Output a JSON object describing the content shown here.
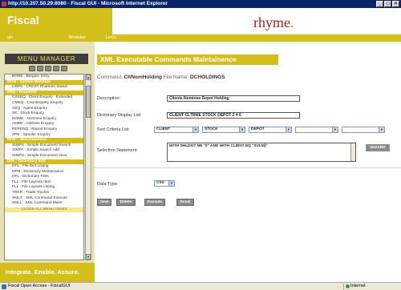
{
  "window": {
    "title": "http://10.207.50.29:8080 - Fiscal GUI - Microsoft Internet Explorer"
  },
  "header": {
    "brand": "Fiscal",
    "logo": "rhyme"
  },
  "nav": {
    "items": [
      "gin",
      "Modules",
      "Links"
    ]
  },
  "sidebar": {
    "title": "MENU MANAGER",
    "tagline": "Integrate. Enable. Assure.",
    "menu": [
      {
        "type": "item",
        "label": "BGNE : Bargain Entry"
      },
      {
        "type": "section",
        "label": "MON : System Monitors"
      },
      {
        "type": "item",
        "label": "CRPS : CREST Phantom Status"
      },
      {
        "type": "section",
        "label": "ENQ : Enquiries"
      },
      {
        "type": "item",
        "label": "CSSEQ : Client Enquiry - Extended"
      },
      {
        "type": "item",
        "label": "CMEQ : Counterparty Enquiry"
      },
      {
        "type": "item",
        "label": "AEQ : Agent Enquiry"
      },
      {
        "type": "item",
        "label": "SE : Stock Enquiry"
      },
      {
        "type": "item",
        "label": "NOME : Nominee Enquiry"
      },
      {
        "type": "item",
        "label": "ADRE : Address Enquiry"
      },
      {
        "type": "item",
        "label": "REPENQ : Report Enquiry"
      },
      {
        "type": "item",
        "label": "SPE : Spooler Enquiry"
      },
      {
        "type": "section",
        "label": "MISC : Miscellaneous"
      },
      {
        "type": "item",
        "label": "SIMPS : Simple Document Search"
      },
      {
        "type": "item",
        "label": "SIMPA : Simple Search Add"
      },
      {
        "type": "item",
        "label": "SIMPS : Simple Document View"
      },
      {
        "type": "section",
        "label": "DDL : Dictionary Edit"
      },
      {
        "type": "item",
        "label": "DFL : File Dict Listing"
      },
      {
        "type": "item",
        "label": "DFM : Dictionary Maintenance"
      },
      {
        "type": "item",
        "label": "DFL : Dictionary Files"
      },
      {
        "type": "item",
        "label": "FLL : File Layouts Item"
      },
      {
        "type": "item",
        "label": "FLL : File Layouts Listing"
      },
      {
        "type": "item",
        "label": "TRKR : Trade Tracker"
      },
      {
        "type": "item",
        "label": "XMLX : XML Command Execute"
      },
      {
        "type": "item",
        "label": "XMLL : XML Command Maint"
      }
    ],
    "close_all": "CLOSE ALL MENU ITEMS"
  },
  "main": {
    "title": "XML Executable Commands Maintainence",
    "command_label": "Command:",
    "command_value": "CltNomHolding",
    "file_label": "File Name:",
    "file_value": "DCHOLDINGS",
    "description_label": "Description:",
    "description_value": "Clients Nominee Depot Holding",
    "dict_label": "Dictionary Display List:",
    "dict_value": "CLIENT CLTRME STOCK DEPOT 2 4 6",
    "sort_label": "Sort Criteria List:",
    "sort_values": [
      "CLIENT",
      "STOCK",
      "DEPOT",
      "",
      ""
    ],
    "selection_label": "Selection Statement:",
    "selection_value": "WITH SHLDGT NE \"0\" AND WITH CLIENT EQ \"SVLM]\"",
    "wizard_label": "WIZARD",
    "datatype_label": "Data Type:",
    "datatype_value": "CSV",
    "buttons": {
      "save": "Save",
      "delete": "Delete",
      "execute": "Execute",
      "excel": "Excel"
    }
  },
  "status": {
    "text": "Fiscal Open Access - FiscalGUI",
    "zone": "Internet"
  }
}
